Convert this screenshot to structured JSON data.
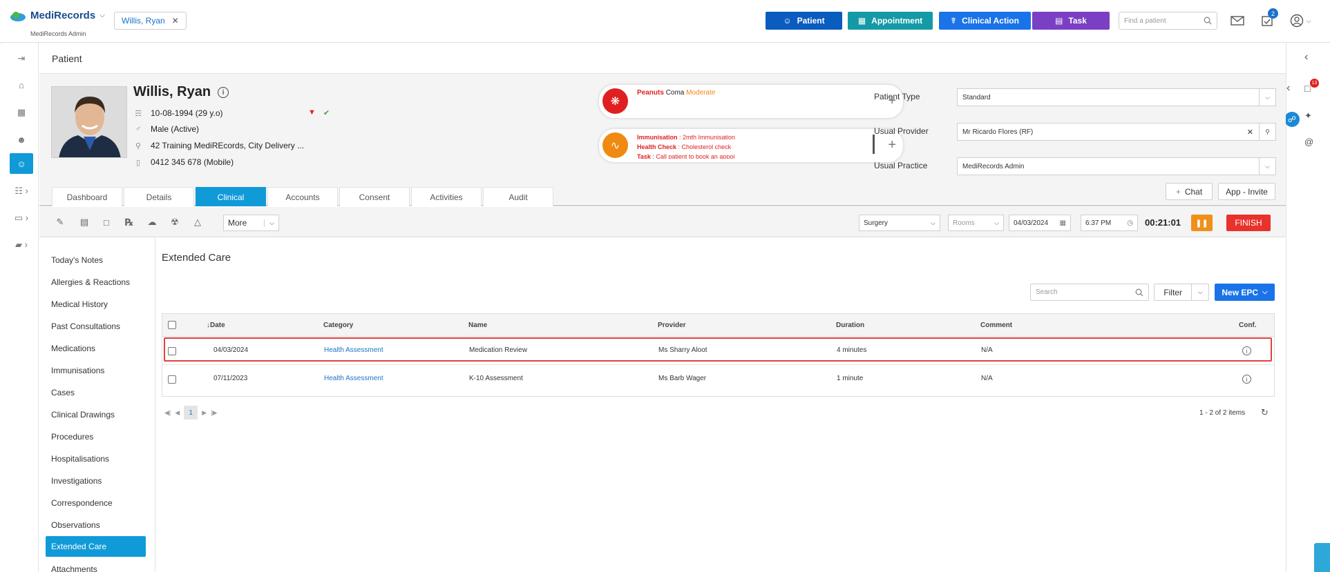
{
  "topbar": {
    "brand": "MediRecords",
    "brand_sub": "MediRecords Admin",
    "open_patient_tab": "Willis, Ryan",
    "buttons": [
      {
        "label": "Patient",
        "color": "#0a5cbf"
      },
      {
        "label": "Appointment",
        "color": "#149aa6"
      },
      {
        "label": "Clinical Action",
        "color": "#1a73e8"
      },
      {
        "label": "Task",
        "color": "#7b3fc4"
      }
    ],
    "find_placeholder": "Find a patient",
    "tasks_badge": "2"
  },
  "page_title": "Patient",
  "patient": {
    "name": "Willis, Ryan",
    "dob": "10-08-1994 (29 y.o)",
    "gender": "Male (Active)",
    "address": "42 Training MediREcords, City Delivery ...",
    "phone": "0412 345 678 (Mobile)"
  },
  "alert_card": {
    "allergen": "Peanuts",
    "reaction": "Coma",
    "severity": "Moderate"
  },
  "reminder_card": [
    {
      "label": "Immunisation",
      "value": "2mth Immunisation"
    },
    {
      "label": "Health Check",
      "value": "Cholesterol check"
    },
    {
      "label": "Task",
      "value": "Call patient to book an appoi"
    }
  ],
  "right_fields": {
    "patient_type_label": "Patient Type",
    "patient_type": "Standard",
    "usual_provider_label": "Usual Provider",
    "usual_provider": "Mr Ricardo Flores (RF)",
    "usual_practice_label": "Usual Practice",
    "usual_practice": "MediRecords Admin",
    "chat": "Chat",
    "app_invite": "App - Invite"
  },
  "tabs": [
    "Dashboard",
    "Details",
    "Clinical",
    "Accounts",
    "Consent",
    "Activities",
    "Audit"
  ],
  "active_tab": "Clinical",
  "toolbar": {
    "more": "More",
    "surgery": "Surgery",
    "rooms_placeholder": "Rooms",
    "date": "04/03/2024",
    "time": "6:37 PM",
    "timer": "00:21:01",
    "finish": "FINISH"
  },
  "left_menu": [
    "Today's Notes",
    "Allergies & Reactions",
    "Medical History",
    "Past Consultations",
    "Medications",
    "Immunisations",
    "Cases",
    "Clinical Drawings",
    "Procedures",
    "Hospitalisations",
    "Investigations",
    "Correspondence",
    "Observations",
    "Extended Care",
    "Attachments"
  ],
  "active_menu": "Extended Care",
  "main": {
    "title": "Extended Care",
    "search_placeholder": "Search",
    "filter": "Filter",
    "new_epc": "New EPC",
    "columns": [
      "Date",
      "Category",
      "Name",
      "Provider",
      "Duration",
      "Comment",
      "Conf."
    ],
    "rows": [
      {
        "date": "04/03/2024",
        "category": "Health Assessment",
        "name": "Medication Review",
        "provider": "Ms Sharry Aloot",
        "duration": "4 minutes",
        "comment": "N/A"
      },
      {
        "date": "07/11/2023",
        "category": "Health Assessment",
        "name": "K-10 Assessment",
        "provider": "Ms Barb Wager",
        "duration": "1 minute",
        "comment": "N/A"
      }
    ],
    "page": "1",
    "count": "1 - 2 of 2 items"
  },
  "right_rail": {
    "notifications_badge": "13"
  }
}
